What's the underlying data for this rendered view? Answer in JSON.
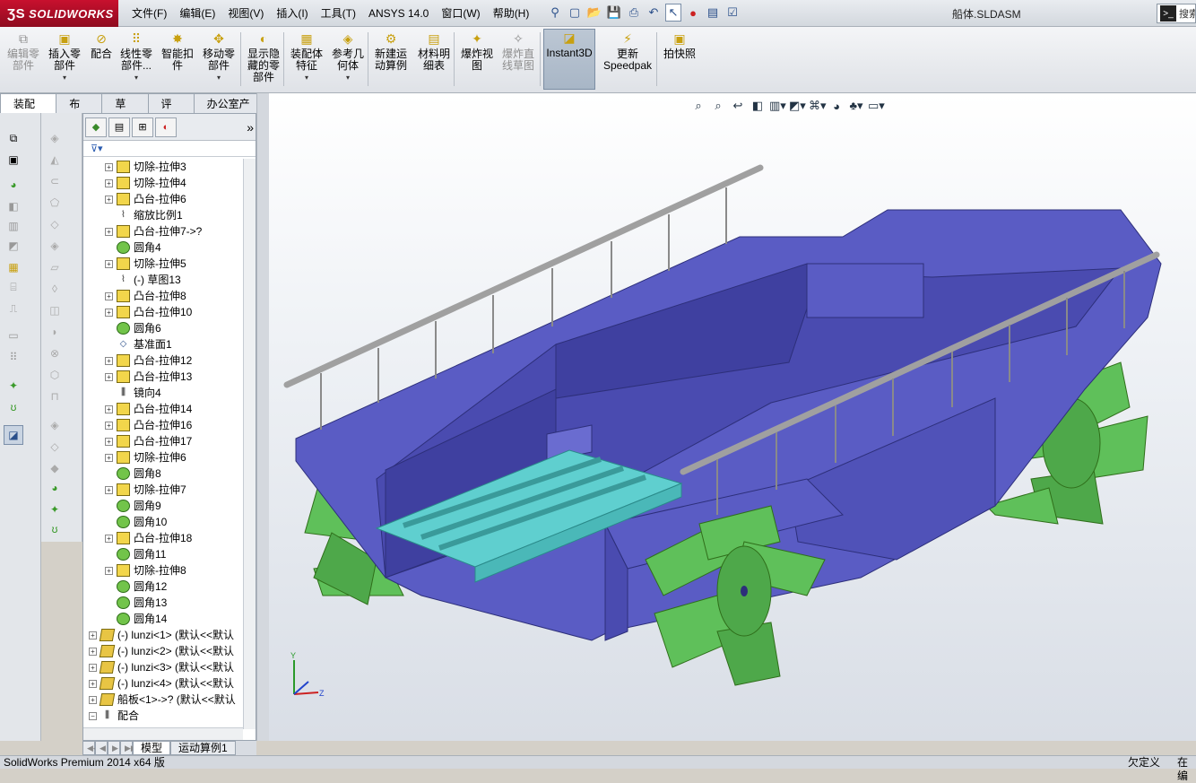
{
  "app": {
    "brand": "SOLIDWORKS",
    "doc_title": "船体.SLDASM",
    "search_label": "搜索"
  },
  "menu": [
    "文件(F)",
    "编辑(E)",
    "视图(V)",
    "插入(I)",
    "工具(T)",
    "ANSYS 14.0",
    "窗口(W)",
    "帮助(H)"
  ],
  "ribbon": {
    "buttons": [
      {
        "name": "edit-component-button",
        "label": "编辑零\n部件",
        "disabled": true,
        "dd": false
      },
      {
        "name": "insert-component-button",
        "label": "插入零\n部件",
        "disabled": false,
        "dd": true
      },
      {
        "name": "mate-button",
        "label": "配合",
        "disabled": false,
        "dd": false
      },
      {
        "name": "linear-pattern-button",
        "label": "线性零\n部件...",
        "disabled": false,
        "dd": true
      },
      {
        "name": "smart-fastener-button",
        "label": "智能扣\n件",
        "disabled": false,
        "dd": false
      },
      {
        "name": "move-component-button",
        "label": "移动零\n部件",
        "disabled": false,
        "dd": true
      },
      {
        "name": "show-hidden-button",
        "label": "显示隐\n藏的零\n部件",
        "disabled": false,
        "dd": false
      },
      {
        "name": "assembly-feature-button",
        "label": "装配体\n特征",
        "disabled": false,
        "dd": true
      },
      {
        "name": "reference-geometry-button",
        "label": "参考几\n何体",
        "disabled": false,
        "dd": true
      },
      {
        "name": "new-motion-study-button",
        "label": "新建运\n动算例",
        "disabled": false,
        "dd": false
      },
      {
        "name": "bom-button",
        "label": "材料明\n细表",
        "disabled": false,
        "dd": false
      },
      {
        "name": "exploded-view-button",
        "label": "爆炸视\n图",
        "disabled": false,
        "dd": false
      },
      {
        "name": "explode-line-sketch-button",
        "label": "爆炸直\n线草图",
        "disabled": true,
        "dd": false
      },
      {
        "name": "instant3d-button",
        "label": "Instant3D",
        "disabled": false,
        "dd": false
      },
      {
        "name": "update-speedpak-button",
        "label": "更新\nSpeedpak",
        "disabled": false,
        "dd": false
      },
      {
        "name": "snapshot-button",
        "label": "拍快照",
        "disabled": false,
        "dd": false
      }
    ]
  },
  "cmd_tabs": [
    "装配体",
    "布局",
    "草图",
    "评估",
    "办公室产品"
  ],
  "tree": [
    {
      "label": "切除-拉伸3",
      "icon": "f"
    },
    {
      "label": "切除-拉伸4",
      "icon": "f"
    },
    {
      "label": "凸台-拉伸6",
      "icon": "f"
    },
    {
      "label": "缩放比例1",
      "icon": "s",
      "noexp": true
    },
    {
      "label": "凸台-拉伸7->?",
      "icon": "f"
    },
    {
      "label": "圆角4",
      "icon": "r",
      "noexp": true
    },
    {
      "label": "切除-拉伸5",
      "icon": "f"
    },
    {
      "label": "(-) 草图13",
      "icon": "s",
      "noexp": true
    },
    {
      "label": "凸台-拉伸8",
      "icon": "f"
    },
    {
      "label": "凸台-拉伸10",
      "icon": "f"
    },
    {
      "label": "圆角6",
      "icon": "r",
      "noexp": true
    },
    {
      "label": "基准面1",
      "icon": "p",
      "noexp": true
    },
    {
      "label": "凸台-拉伸12",
      "icon": "f"
    },
    {
      "label": "凸台-拉伸13",
      "icon": "f"
    },
    {
      "label": "镜向4",
      "icon": "m",
      "noexp": true
    },
    {
      "label": "凸台-拉伸14",
      "icon": "f"
    },
    {
      "label": "凸台-拉伸16",
      "icon": "f"
    },
    {
      "label": "凸台-拉伸17",
      "icon": "f"
    },
    {
      "label": "切除-拉伸6",
      "icon": "f"
    },
    {
      "label": "圆角8",
      "icon": "r",
      "noexp": true
    },
    {
      "label": "切除-拉伸7",
      "icon": "f"
    },
    {
      "label": "圆角9",
      "icon": "r",
      "noexp": true
    },
    {
      "label": "圆角10",
      "icon": "r",
      "noexp": true
    },
    {
      "label": "凸台-拉伸18",
      "icon": "f"
    },
    {
      "label": "圆角11",
      "icon": "r",
      "noexp": true
    },
    {
      "label": "切除-拉伸8",
      "icon": "f"
    },
    {
      "label": "圆角12",
      "icon": "r",
      "noexp": true
    },
    {
      "label": "圆角13",
      "icon": "r",
      "noexp": true
    },
    {
      "label": "圆角14",
      "icon": "r",
      "noexp": true
    },
    {
      "label": "(-) lunzi<1> (默认<<默认",
      "icon": "a",
      "top": true
    },
    {
      "label": "(-) lunzi<2> (默认<<默认",
      "icon": "a",
      "top": true
    },
    {
      "label": "(-) lunzi<3> (默认<<默认",
      "icon": "a",
      "top": true
    },
    {
      "label": "(-) lunzi<4> (默认<<默认",
      "icon": "a",
      "top": true
    },
    {
      "label": "船板<1>->? (默认<<默认",
      "icon": "a",
      "top": true
    },
    {
      "label": "配合",
      "icon": "m",
      "top": true,
      "minus": true
    }
  ],
  "bottom_tabs": [
    "模型",
    "运动算例1"
  ],
  "status": {
    "left": "SolidWorks Premium 2014 x64 版",
    "def": "欠定义",
    "edit": "在编"
  },
  "colors": {
    "hull": "#5a5cc4",
    "paddle": "#5fc05a",
    "deck": "#5fcfcf",
    "rail": "#9a9a9a"
  }
}
